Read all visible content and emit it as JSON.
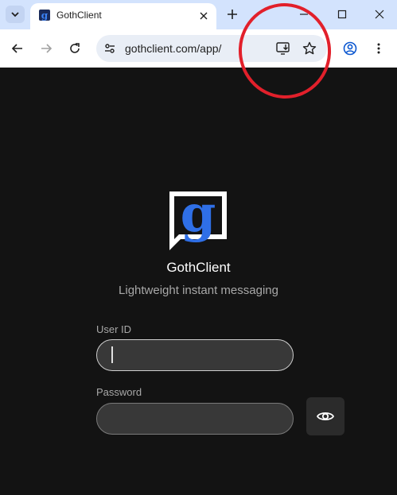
{
  "browser": {
    "tab": {
      "title": "GothClient"
    },
    "address_bar": {
      "url": "gothclient.com/app/"
    }
  },
  "app": {
    "name": "GothClient",
    "tagline": "Lightweight instant messaging",
    "user_id": {
      "label": "User ID",
      "value": ""
    },
    "password": {
      "label": "Password",
      "value": ""
    }
  },
  "colors": {
    "background": "#131313",
    "logo_blue": "#2f6fe6",
    "annotation_circle": "#e2202b"
  }
}
